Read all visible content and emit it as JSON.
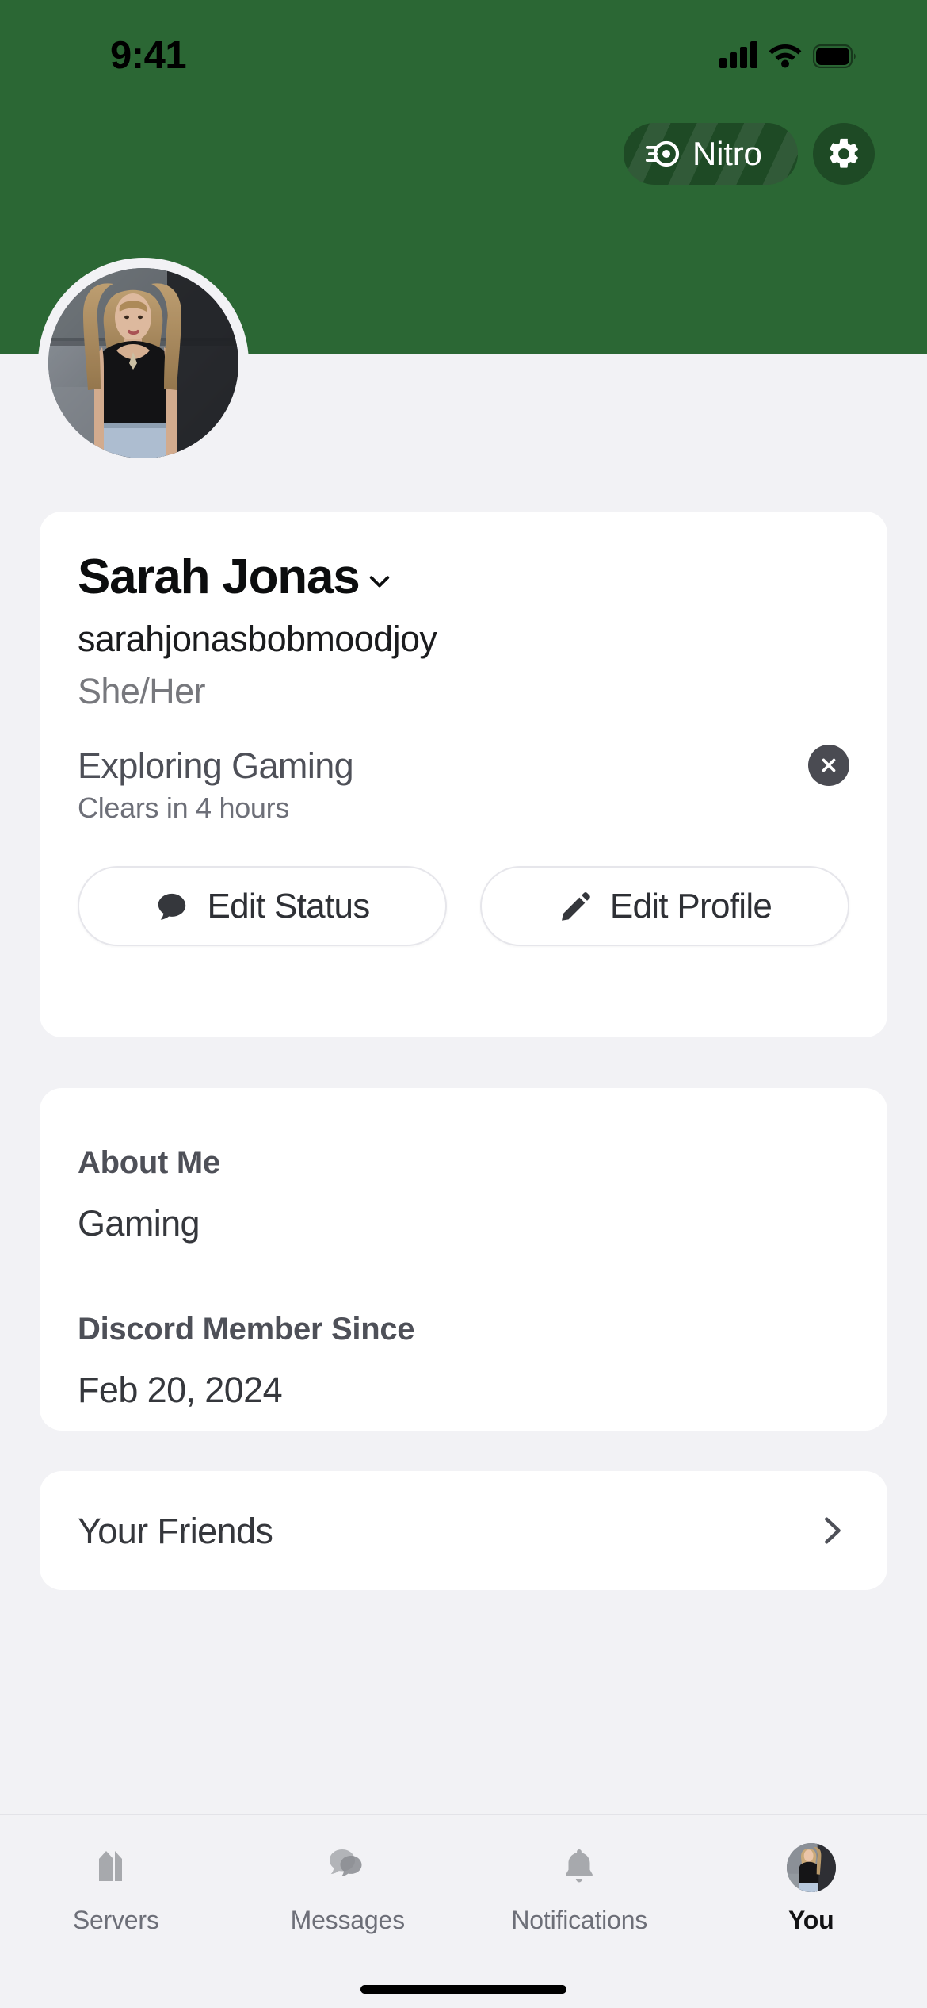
{
  "status_bar": {
    "time": "9:41",
    "signal_icon": "cellular-signal-icon",
    "wifi_icon": "wifi-icon",
    "battery_icon": "battery-icon"
  },
  "header": {
    "banner_color": "#2B6734",
    "nitro_label": "Nitro",
    "nitro_icon": "nitro-wheel-icon",
    "settings_icon": "gear-icon",
    "button_color": "#1E4A25"
  },
  "profile": {
    "avatar_alt": "user-avatar",
    "display_name": "Sarah Jonas",
    "name_chevron_icon": "chevron-down-icon",
    "username": "sarahjonasbobmoodjoy",
    "pronouns": "She/Her",
    "status_text": "Exploring Gaming",
    "status_clear_icon": "close-icon",
    "status_expiry": "Clears in 4 hours",
    "edit_status_label": "Edit Status",
    "edit_status_icon": "speech-bubble-icon",
    "edit_profile_label": "Edit Profile",
    "edit_profile_icon": "pencil-icon"
  },
  "about": {
    "about_me_heading": "About Me",
    "about_me_body": "Gaming",
    "member_since_heading": "Discord Member Since",
    "member_since_body": "Feb 20, 2024"
  },
  "friends": {
    "label": "Your Friends",
    "chevron_icon": "chevron-right-icon"
  },
  "tabbar": {
    "tabs": [
      {
        "label": "Servers",
        "icon": "servers-icon",
        "active": false
      },
      {
        "label": "Messages",
        "icon": "messages-icon",
        "active": false
      },
      {
        "label": "Notifications",
        "icon": "bell-icon",
        "active": false
      },
      {
        "label": "You",
        "icon": "avatar-icon",
        "active": true
      }
    ]
  }
}
